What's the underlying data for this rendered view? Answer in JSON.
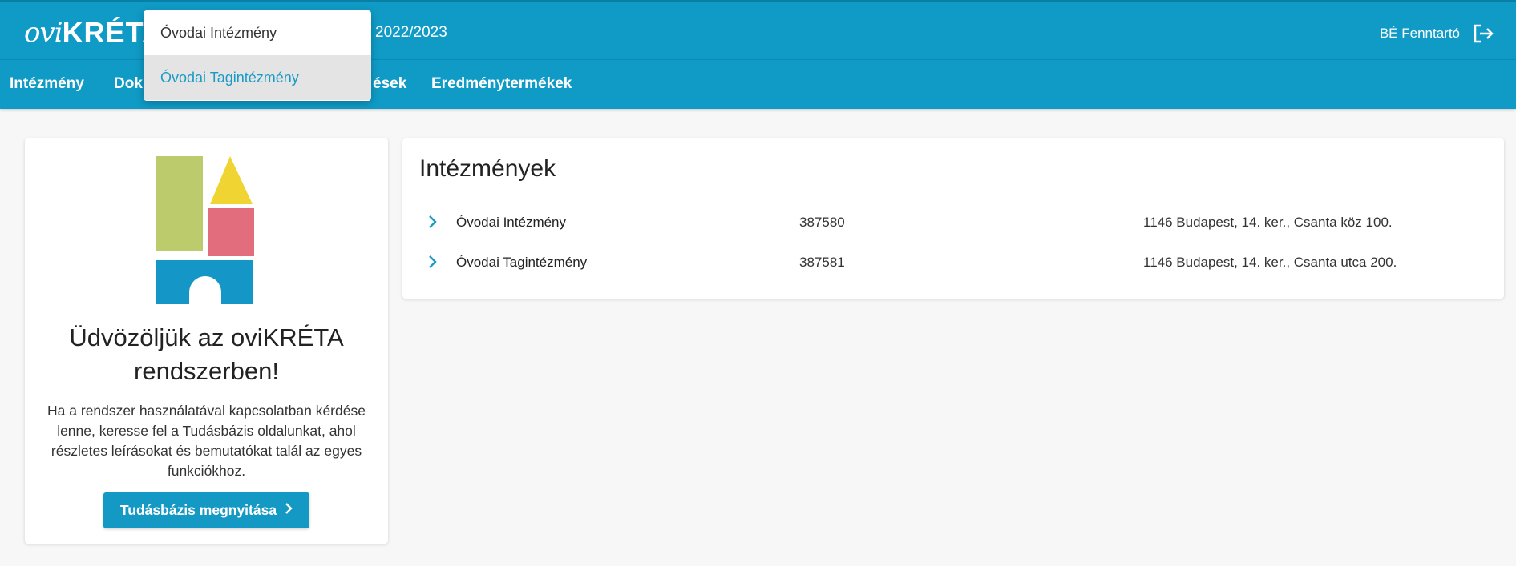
{
  "header": {
    "logo_ovi": "ovi",
    "logo_kreta": "KRÉTA",
    "school_year": "2022/2023",
    "user_name": "BÉ Fenntartó",
    "logout_icon": "logout-icon"
  },
  "nav": {
    "items": [
      "Intézmény",
      "Dok",
      "ések",
      "Eredménytermékek"
    ]
  },
  "dropdown": {
    "items": [
      "Óvodai Intézmény",
      "Óvodai Tagintézmény"
    ],
    "active_index": 1
  },
  "welcome": {
    "title": "Üdvözöljük az oviKRÉTA rendszerben!",
    "text": "Ha a rendszer használatával kapcsolatban kérdése lenne, keresse fel a Tudásbázis oldalunkat, ahol részletes leírásokat és bemutatókat talál az egyes funkciókhoz.",
    "button_label": "Tudásbázis megnyitása"
  },
  "institutions": {
    "title": "Intézmények",
    "rows": [
      {
        "name": "Óvodai Intézmény",
        "code": "387580",
        "address": "1146 Budapest, 14. ker., Csanta köz 100."
      },
      {
        "name": "Óvodai Tagintézmény",
        "code": "387581",
        "address": "1146 Budapest, 14. ker., Csanta utca 200."
      }
    ]
  },
  "colors": {
    "brand": "#0f9bc6",
    "button": "#1499c5",
    "block_green": "#bccb6c",
    "block_yellow": "#f0d432",
    "block_pink": "#e26d7d",
    "block_blue": "#1496c6"
  }
}
